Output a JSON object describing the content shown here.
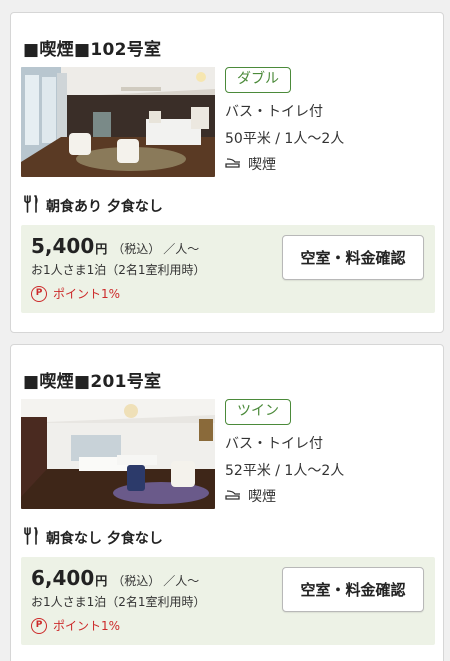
{
  "rooms": [
    {
      "title": "■喫煙■102号室",
      "type": "ダブル",
      "bath": "バス・トイレ付",
      "size": "50平米 / 1人〜2人",
      "smoking": "喫煙",
      "meals": "朝食あり 夕食なし",
      "price": "5,400",
      "currency": "円",
      "tax": "（税込）",
      "per": "／人〜",
      "price_note": "お1人さま1泊（2名1室利用時）",
      "point_icon": "P",
      "points": "ポイント1%",
      "button": "空室・料金確認"
    },
    {
      "title": "■喫煙■201号室",
      "type": "ツイン",
      "bath": "バス・トイレ付",
      "size": "52平米 / 1人〜2人",
      "smoking": "喫煙",
      "meals": "朝食なし 夕食なし",
      "price": "6,400",
      "currency": "円",
      "tax": "（税込）",
      "per": "／人〜",
      "price_note": "お1人さま1泊（2名1室利用時）",
      "point_icon": "P",
      "points": "ポイント1%",
      "button": "空室・料金確認"
    }
  ],
  "icons": {
    "meal": "fork-knife-icon",
    "smoking": "cigarette-icon",
    "points": "point-p-icon"
  },
  "colors": {
    "accent_green": "#4b8a3a",
    "price_bg": "#edf2e6",
    "point_red": "#cc2a2a"
  }
}
